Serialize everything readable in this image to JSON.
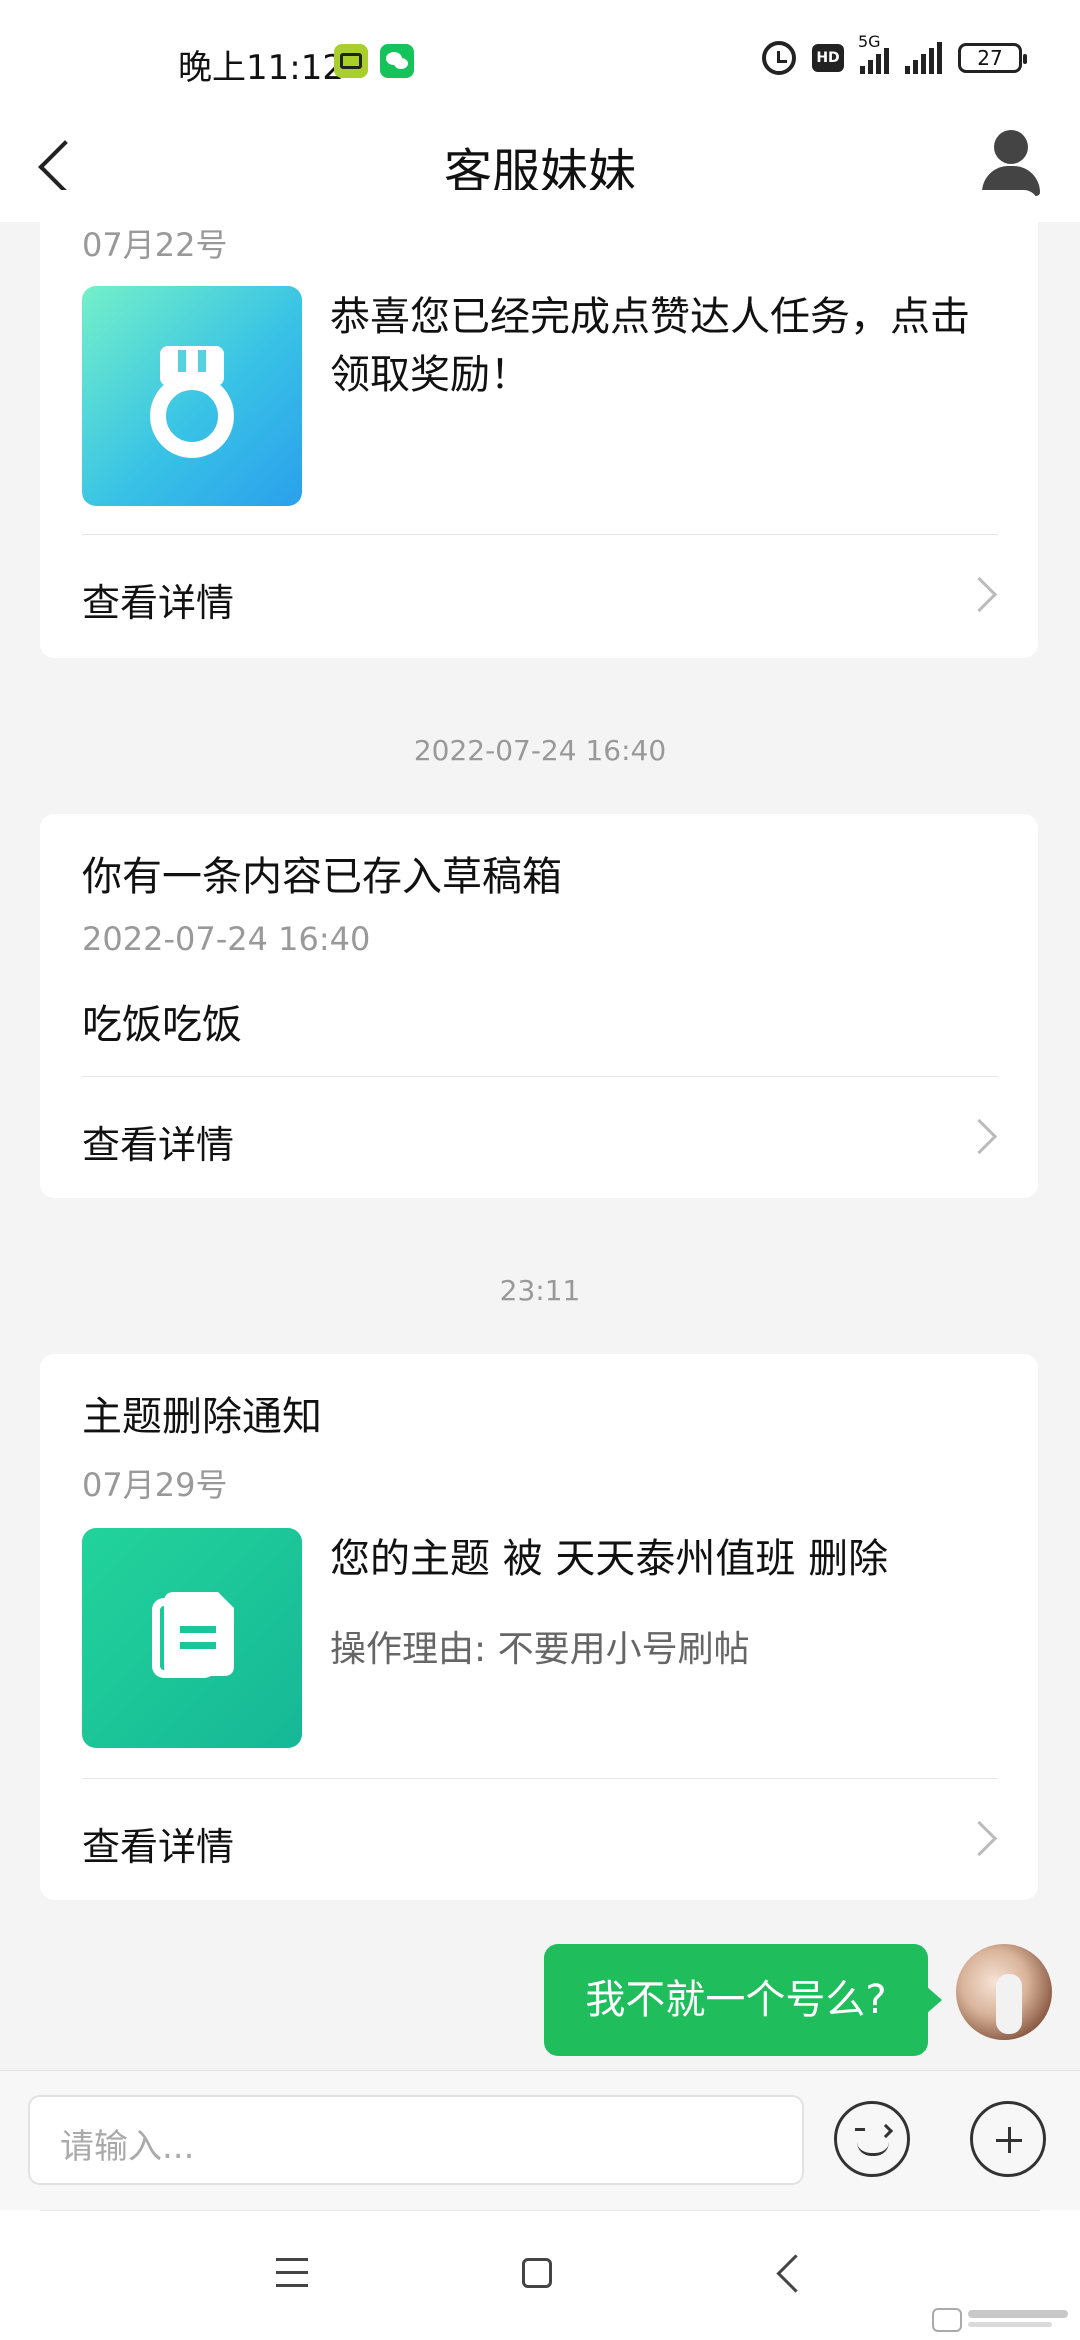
{
  "status_bar": {
    "time": "晚上11:12",
    "network": "5G",
    "hd_label": "HD",
    "battery": "27"
  },
  "header": {
    "title": "客服妹妹"
  },
  "messages": [
    {
      "date": "07月22号",
      "description": "恭喜您已经完成点赞达人任务，点击领取奖励！",
      "thumbnail_icon": "medal-icon",
      "link_label": "查看详情"
    },
    {
      "timestamp": "2022-07-24 16:40",
      "title": "你有一条内容已存入草稿箱",
      "date": "2022-07-24 16:40",
      "body": "吃饭吃饭",
      "link_label": "查看详情"
    },
    {
      "timestamp": "23:11",
      "title": "主题删除通知",
      "date": "07月29号",
      "description": "您的主题 被 天天泰州值班 删除",
      "reason": "操作理由: 不要用小号刷帖",
      "thumbnail_icon": "document-icon",
      "link_label": "查看详情"
    }
  ],
  "sent_message": {
    "text": "我不就一个号么?"
  },
  "input": {
    "placeholder": "请输入..."
  },
  "colors": {
    "accent_green": "#1fbd5c",
    "medal_gradient": "#39c3e5",
    "doc_gradient": "#16b896"
  }
}
